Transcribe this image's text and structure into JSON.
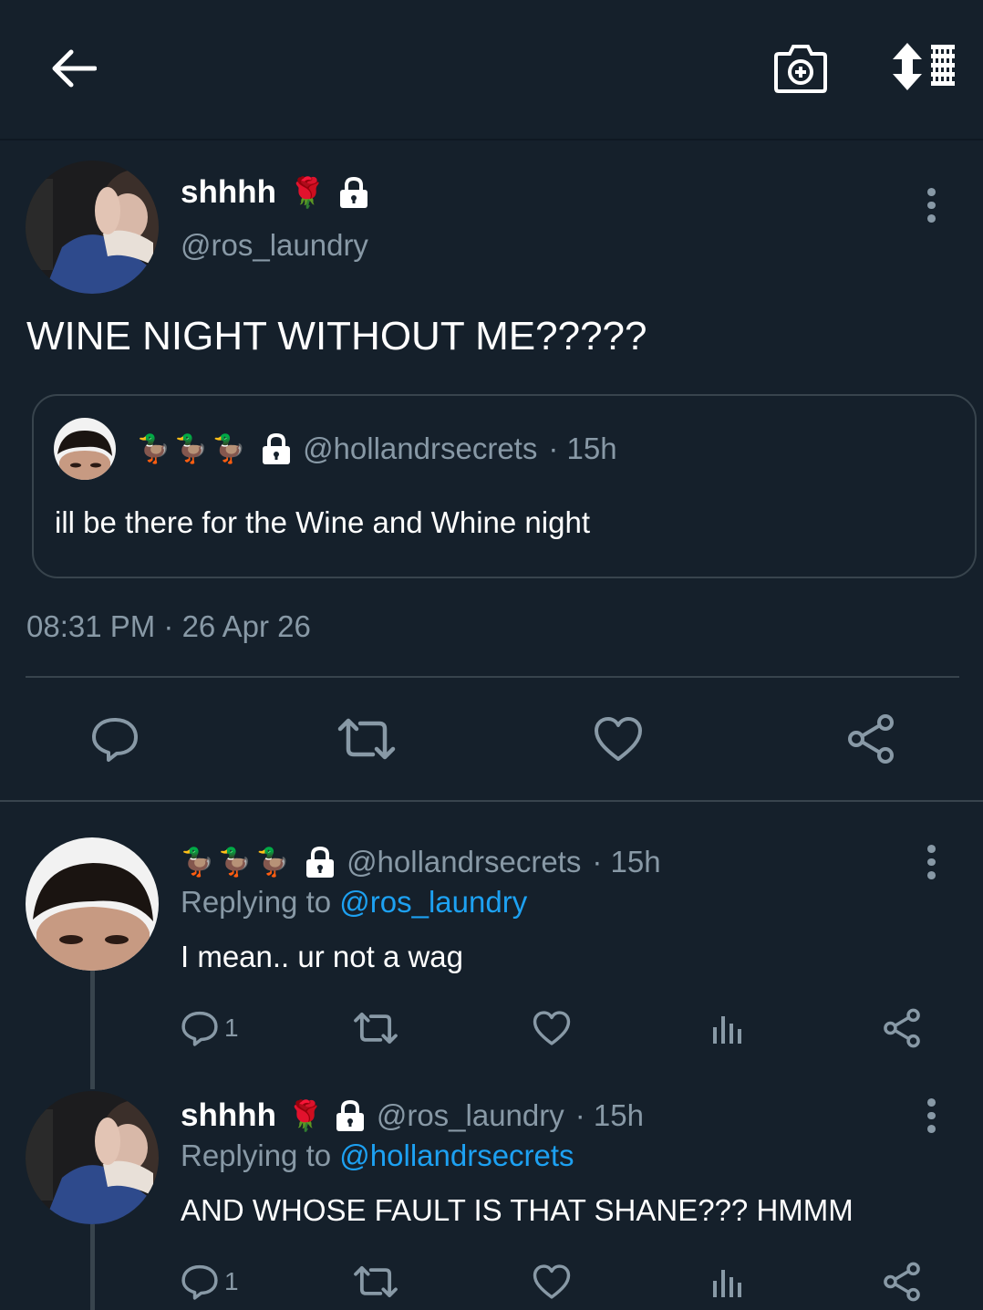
{
  "header": {
    "back_icon": "back-arrow-icon",
    "camera_icon": "camera-plus-icon",
    "sort_icon": "sort-list-icon"
  },
  "main_tweet": {
    "display_name": "shhhh",
    "name_emoji": "🌹",
    "username": "@ros_laundry",
    "text": "WINE NIGHT WITHOUT ME?????",
    "timestamp": "08:31 PM · 26 Apr 26",
    "quoted": {
      "name_emojis": "🦆🦆🦆",
      "username": "@hollandrsecrets",
      "time": "· 15h",
      "text": "ill be there for the Wine and Whine night"
    }
  },
  "replies": [
    {
      "name_emojis": "🦆🦆🦆",
      "username": "@hollandrsecrets",
      "time": "· 15h",
      "replying_prefix": "Replying to",
      "replying_to": "@ros_laundry",
      "text": "I mean.. ur not a wag",
      "reply_count": "1"
    },
    {
      "display_name": "shhhh",
      "name_emoji": "🌹",
      "username": "@ros_laundry",
      "time": "· 15h",
      "replying_prefix": "Replying to",
      "replying_to": "@hollandrsecrets",
      "text": "AND WHOSE FAULT IS THAT SHANE??? HMMM",
      "reply_count": "1"
    }
  ],
  "colors": {
    "background": "#15202b",
    "secondary_text": "#8899a6",
    "link": "#1da1f2",
    "border": "#38444d"
  }
}
